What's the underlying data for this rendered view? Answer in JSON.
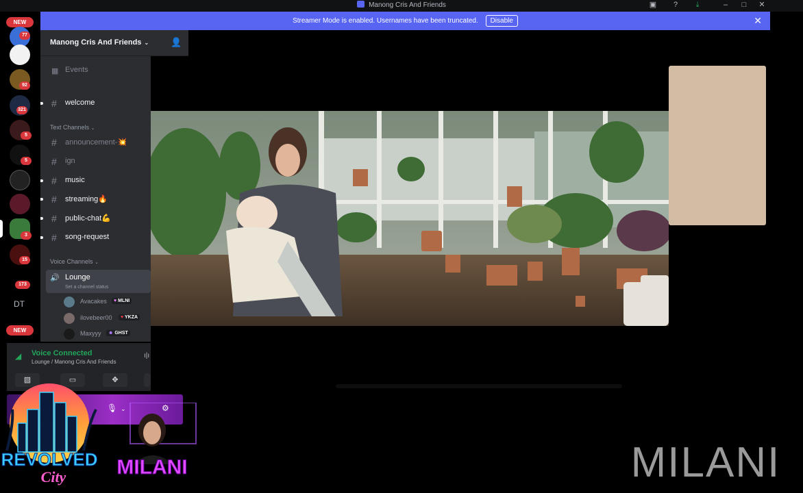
{
  "window": {
    "title": "Manong Cris And Friends",
    "controls": [
      "inbox-icon",
      "help-icon",
      "download-icon",
      "minimize-icon",
      "maximize-icon",
      "close-icon"
    ]
  },
  "banner": {
    "text": "Streamer Mode is enabled. Usernames have been truncated.",
    "button": "Disable"
  },
  "rail": {
    "badges": [
      {
        "type": "new",
        "text": "NEW"
      },
      {
        "type": "count",
        "text": "77"
      },
      {
        "type": "count",
        "text": "92"
      },
      {
        "type": "count",
        "text": "321"
      },
      {
        "type": "count",
        "text": "5"
      },
      {
        "type": "count",
        "text": "5"
      },
      {
        "type": "count",
        "text": "3"
      },
      {
        "type": "count",
        "text": "15"
      },
      {
        "type": "count",
        "text": "173"
      },
      {
        "type": "new",
        "text": "NEW"
      }
    ],
    "dm_label": "DT"
  },
  "server": {
    "name": "Manong Cris And Friends",
    "events": "Events",
    "channels_top": [
      {
        "label": "welcome",
        "unread": true
      }
    ],
    "text_category": "Text Channels",
    "text_channels": [
      {
        "label": "announcement-",
        "emoji": "💥",
        "unread": false
      },
      {
        "label": "ign",
        "emoji": "",
        "unread": false
      },
      {
        "label": "music",
        "emoji": "",
        "unread": true
      },
      {
        "label": "streaming",
        "emoji": "🔥",
        "unread": true
      },
      {
        "label": "public-chat",
        "emoji": "💪",
        "unread": true
      },
      {
        "label": "song-request",
        "emoji": "",
        "unread": true
      }
    ],
    "voice_category": "Voice Channels",
    "voice_channel": {
      "name": "Lounge",
      "status": "Set a channel status"
    },
    "voice_users": [
      {
        "name": "Avacakes",
        "tag": "MLNI",
        "tag_icon": "♥"
      },
      {
        "name": "ilovebeer00",
        "tag": "YKZA",
        "tag_icon": "♥"
      },
      {
        "name": "Maxyyy",
        "tag": "GHST",
        "tag_icon": "☻"
      }
    ]
  },
  "voice_panel": {
    "title": "Voice Connected",
    "subtitle": "Lounge / Manong Cris And Friends"
  },
  "overlay": {
    "logo_text": "REVOLVED",
    "logo_sub": "City",
    "cam_name": "MILANI",
    "watermark": "MILANI"
  },
  "colors": {
    "accent": "#5865f2",
    "voice_green": "#23a55a",
    "badge_red": "#da373c",
    "tile_beige": "#d2bca3"
  }
}
